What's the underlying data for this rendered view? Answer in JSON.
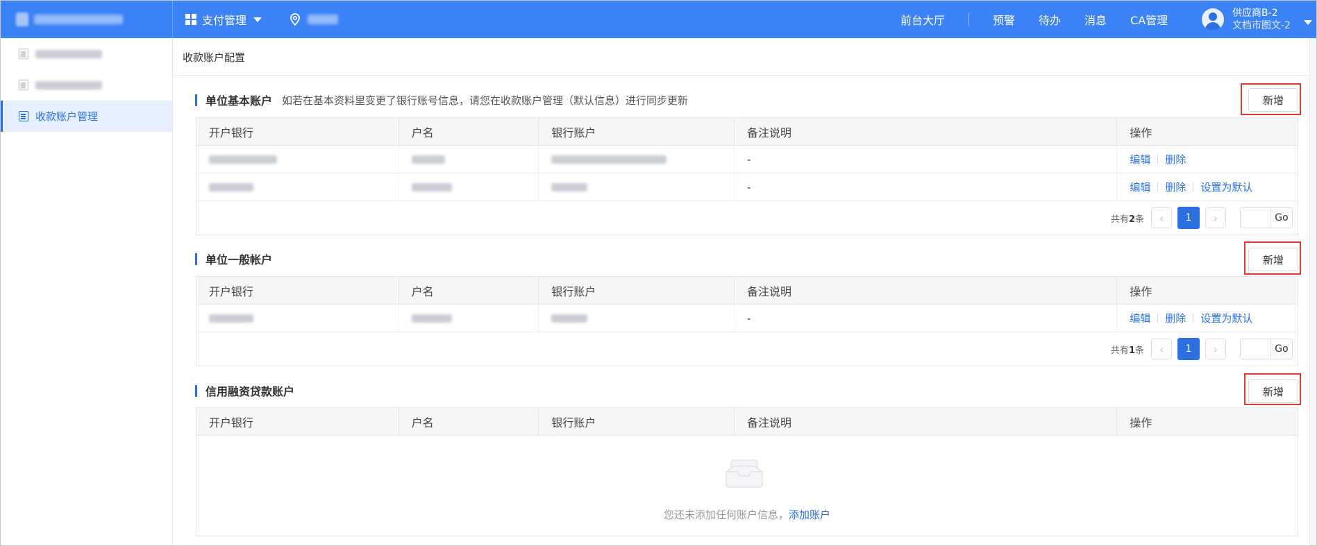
{
  "header": {
    "brand": "",
    "pay_menu_label": "支付管理",
    "location_label": "",
    "nav": [
      "前台大厅",
      "预警",
      "待办",
      "消息",
      "CA管理"
    ],
    "user_name": "供应商B-2",
    "user_org": "文档市图文-2"
  },
  "sidebar": {
    "items": [
      {
        "label": "",
        "active": false
      },
      {
        "label": "",
        "active": false
      },
      {
        "label": "收款账户管理",
        "active": true
      }
    ]
  },
  "breadcrumb": "收款账户配置",
  "table_headers": [
    "开户银行",
    "户名",
    "银行账户",
    "备注说明",
    "操作"
  ],
  "sections": [
    {
      "title": "单位基本账户",
      "hint": "如若在基本资料里变更了银行账号信息，请您在收款账户管理（默认信息）进行同步更新",
      "add_label": "新增",
      "rows": [
        {
          "bank": "",
          "name": "",
          "account": "",
          "remark": "-",
          "ops": [
            "编辑",
            "删除"
          ]
        },
        {
          "bank": "",
          "name": "",
          "account": "",
          "remark": "-",
          "ops": [
            "编辑",
            "删除",
            "设置为默认"
          ]
        }
      ],
      "pager": {
        "prefix": "共有",
        "count": "2",
        "suffix": "条",
        "page": "1",
        "go": "Go"
      }
    },
    {
      "title": "单位一般帐户",
      "hint": "",
      "add_label": "新增",
      "rows": [
        {
          "bank": "",
          "name": "",
          "account": "",
          "remark": "-",
          "ops": [
            "编辑",
            "删除",
            "设置为默认"
          ]
        }
      ],
      "pager": {
        "prefix": "共有",
        "count": "1",
        "suffix": "条",
        "page": "1",
        "go": "Go"
      }
    },
    {
      "title": "信用融资贷款账户",
      "hint": "",
      "add_label": "新增",
      "rows": [],
      "empty_text": "您还未添加任何账户信息，",
      "empty_link": "添加账户"
    }
  ],
  "colors": {
    "primary": "#3b82f6",
    "link": "#2b6fe0",
    "highlight_frame": "#e53935"
  }
}
